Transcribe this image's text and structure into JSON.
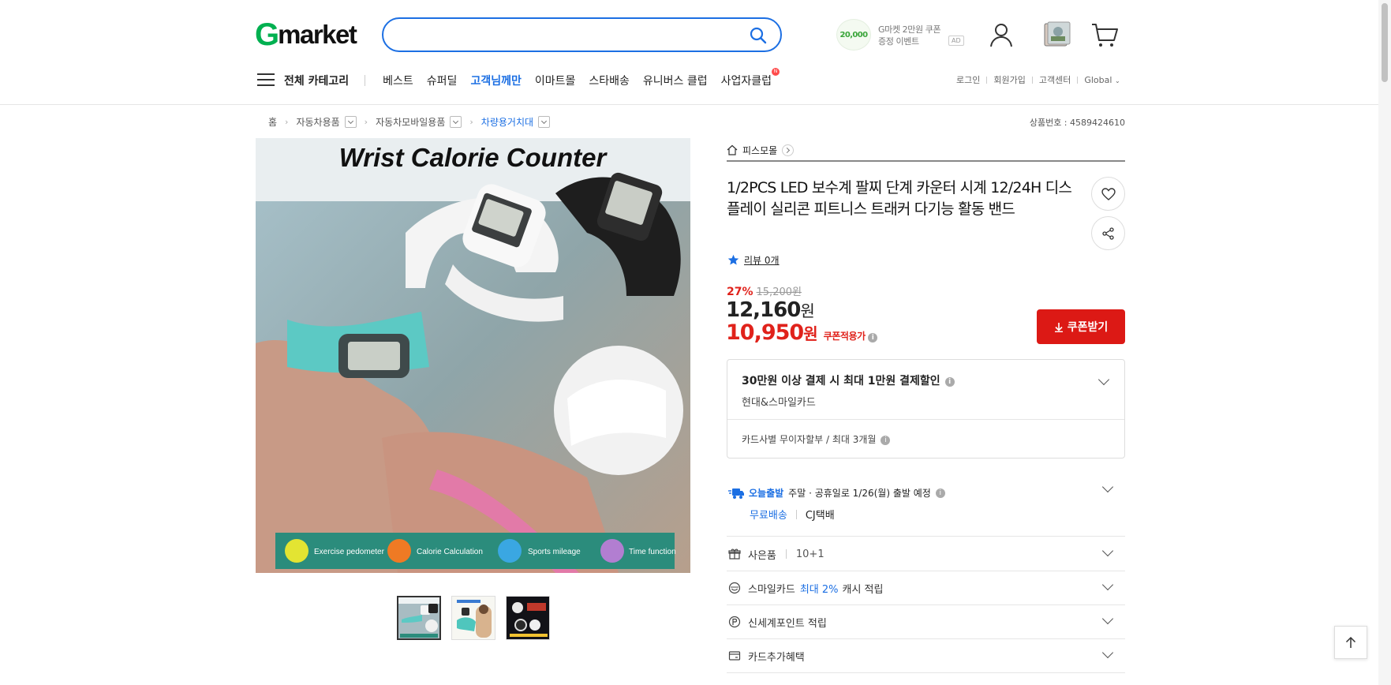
{
  "header": {
    "logo": {
      "g": "G",
      "rest": "market"
    },
    "search": {
      "value": "",
      "placeholder": ""
    },
    "ad": {
      "coin": "20,000",
      "line1": "G마켓 2만원 쿠폰",
      "line2": "증정 이벤트",
      "badge": "AD"
    }
  },
  "gnb": {
    "all_category": "전체 카테고리",
    "items": [
      "베스트",
      "슈퍼딜",
      "고객님께만",
      "이마트몰",
      "스타배송",
      "유니버스 클럽",
      "사업자클럽"
    ],
    "new_badge": "N",
    "util": [
      "로그인",
      "회원가입",
      "고객센터",
      "Global"
    ]
  },
  "breadcrumb": {
    "items": [
      "홈",
      "자동차용품",
      "자동차모바일용품",
      "차량용거치대"
    ]
  },
  "product_no": "상품번호 : 4589424610",
  "image": {
    "headline": "Wrist Calorie Counter",
    "features": [
      "Exercise pedometer",
      "Calorie Calculation",
      "Sports mileage",
      "Time function"
    ]
  },
  "shop": {
    "name": "피스모몰"
  },
  "title": "1/2PCS LED 보수계 팔찌 단계 카운터 시계 12/24H 디스플레이 실리콘 피트니스 트래커 다기능 활동 밴드",
  "review": "리뷰 0개",
  "price": {
    "discount_pct": "27%",
    "original": "15,200원",
    "sale": "12,160",
    "sale_unit": "원",
    "coupon_price": "10,950",
    "coupon_unit": "원",
    "coupon_label": "쿠폰적용가",
    "coupon_button": "쿠폰받기"
  },
  "card_benefit": {
    "title": "30만원 이상 결제 시 최대 1만원 결제할인",
    "sub": "현대&스마일카드",
    "installment": "카드사별 무이자할부 / 최대 3개월"
  },
  "shipping": {
    "today": "오늘출발",
    "desc": "주말 · 공휴일로 1/26(월) 출발 예정",
    "free": "무료배송",
    "courier": "CJ택배"
  },
  "options": [
    {
      "label": "사은품",
      "value": "10+1"
    },
    {
      "label": "스마일카드",
      "highlight": "최대 2%",
      "tail": "캐시 적립"
    },
    {
      "label": "신세계포인트 적립"
    },
    {
      "label": "카드추가혜택"
    }
  ],
  "colors": {
    "brand_blue": "#1c6fe3",
    "sale_red": "#e0221b",
    "logo_green": "#00b050"
  }
}
